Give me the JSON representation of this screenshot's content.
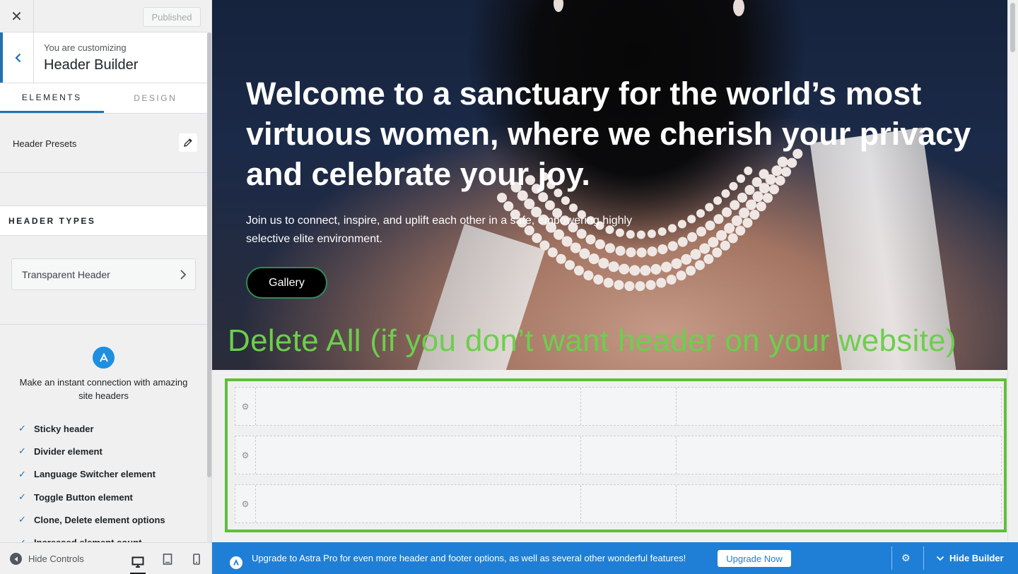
{
  "sidebar": {
    "published_label": "Published",
    "customizing_label": "You are customizing",
    "customizing_title": "Header Builder",
    "tabs": [
      {
        "label": "ELEMENTS",
        "active": true
      },
      {
        "label": "DESIGN",
        "active": false
      }
    ],
    "header_presets_label": "Header Presets",
    "header_types_heading": "HEADER TYPES",
    "transparent_header_label": "Transparent Header",
    "upsell_text": "Make an instant connection with amazing site headers",
    "features": [
      "Sticky header",
      "Divider element",
      "Language Switcher element",
      "Toggle Button element",
      "Clone, Delete element options",
      "Increased element count"
    ],
    "hide_controls_label": "Hide Controls",
    "devices": [
      {
        "icon": "desktop-icon",
        "active": true
      },
      {
        "icon": "tablet-icon",
        "active": false
      },
      {
        "icon": "mobile-icon",
        "active": false
      }
    ]
  },
  "preview": {
    "hero_title": "Welcome to a sanctuary for the world’s most virtuous women, where we cherish your privacy and celebrate your joy.",
    "hero_subtitle": "Join us to connect, inspire, and uplift each other in a safe, empowering highly selective elite environment.",
    "gallery_button": "Gallery",
    "annotation": "Delete All (if you don’t want header on your website)"
  },
  "bottom_bar": {
    "upgrade_text": "Upgrade to Astra Pro for even more header and footer options, as well as several other wonderful features!",
    "upgrade_button": "Upgrade Now",
    "hide_builder_label": "Hide Builder"
  },
  "colors": {
    "accent": "#2271b1",
    "bottom_bar": "#1f7fd6",
    "annotation_green": "#6ccf4c",
    "highlight_border": "#5fbe3b"
  }
}
